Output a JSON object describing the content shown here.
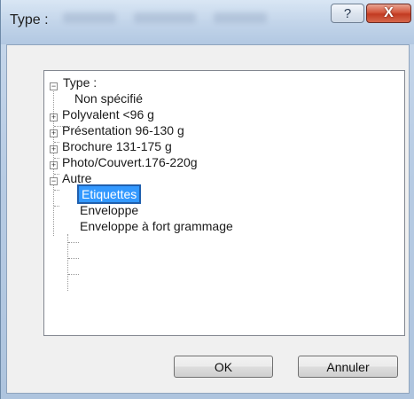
{
  "window": {
    "title": "Type :"
  },
  "titlebar": {
    "help_label": "?",
    "close_label": "X"
  },
  "tree": {
    "root_label": "Type :",
    "items": [
      {
        "label": "Non spécifié"
      },
      {
        "label": "Polyvalent <96 g"
      },
      {
        "label": "Présentation 96-130 g"
      },
      {
        "label": "Brochure 131-175 g"
      },
      {
        "label": "Photo/Couvert.176-220g"
      },
      {
        "label": "Autre"
      },
      {
        "label": "Etiquettes",
        "selected": true
      },
      {
        "label": "Enveloppe"
      },
      {
        "label": "Enveloppe à fort grammage"
      }
    ]
  },
  "buttons": {
    "ok_label": "OK",
    "cancel_label": "Annuler"
  },
  "colors": {
    "selection": "#3399ff",
    "close_button": "#c23a22"
  }
}
